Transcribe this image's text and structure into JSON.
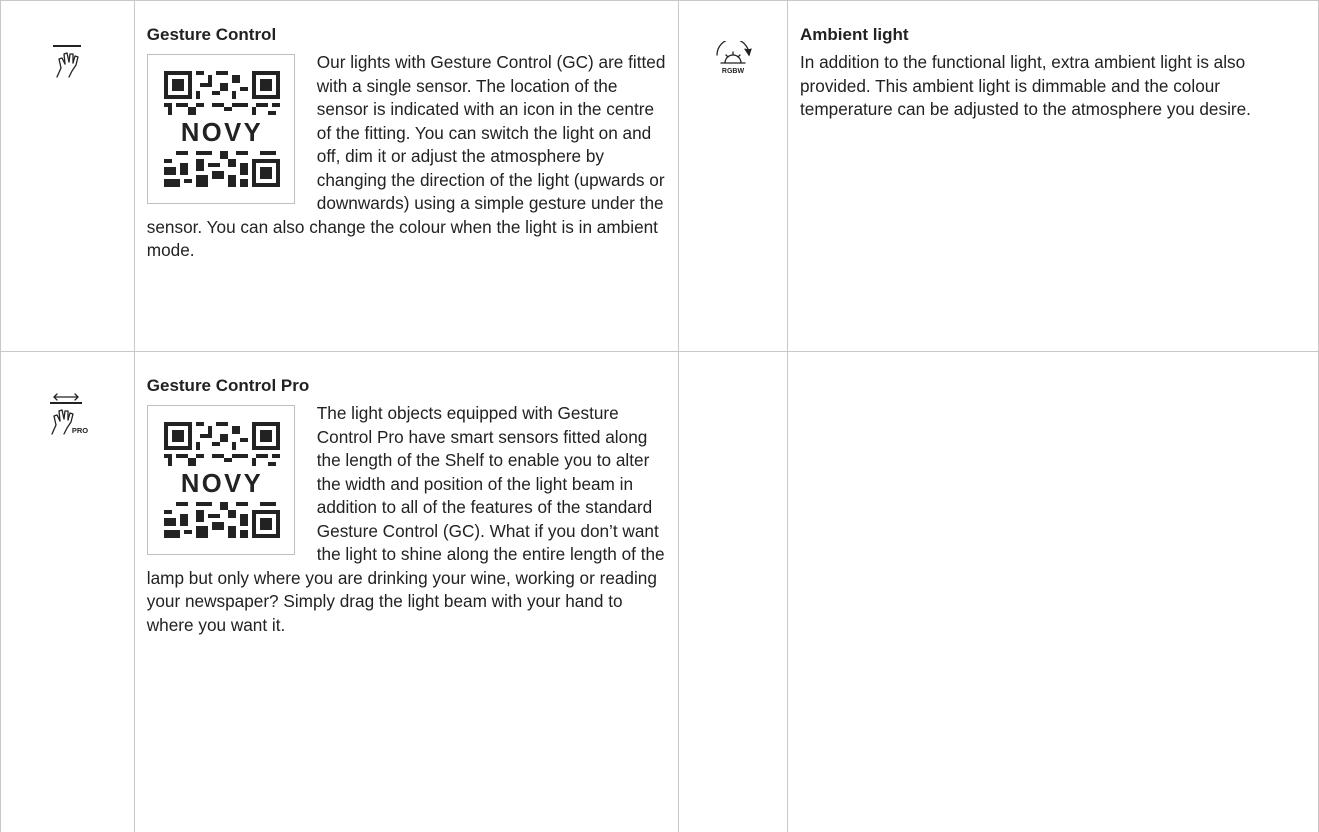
{
  "sections": [
    {
      "title": "Gesture Control",
      "body": "Our lights with Gesture Control (GC) are fitted with a single sensor. The location of the sensor is indicated with an icon in the centre of the fitting. You can switch the light on and off, dim it or adjust the atmosphere by changing the direction of the light (upwards or downwards) using a simple gesture under the sensor. You can also change the colour when the light is in ambient mode.",
      "icon": "gesture-hand-icon",
      "qr_text": "NOVY"
    },
    {
      "title": "Ambient light",
      "body": "In addition to the functional light, extra ambient light is also provided. This ambient light is dimmable and the colour temperature can be adjusted to the atmosphere you desire.",
      "icon": "rgbw-dimmer-icon",
      "icon_label": "RGBW"
    },
    {
      "title": "Gesture Control Pro",
      "body": "The light objects equipped with Gesture Control Pro have smart sensors fitted  along the length of the Shelf to enable you to alter the width and position of the light beam in addition to all of the features of the standard Gesture Control (GC). What if you don’t want the light to shine along the entire length of the lamp but only where you are drinking your wine, working or reading your newspaper? Simply drag the light beam with your hand to where you want it.",
      "icon": "gesture-pro-hand-icon",
      "icon_label": "PRO",
      "qr_text": "NOVY"
    }
  ]
}
